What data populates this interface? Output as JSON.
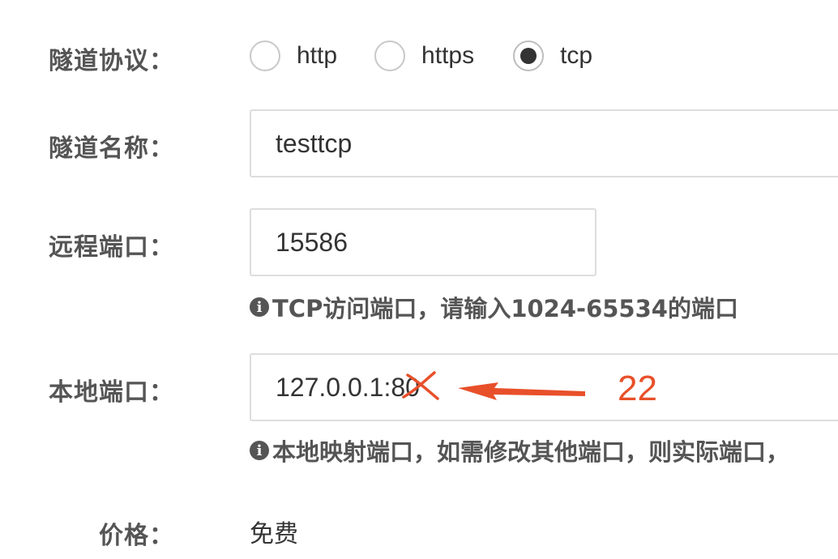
{
  "form": {
    "protocol": {
      "label": "隧道协议：",
      "options": [
        {
          "label": "http",
          "checked": false
        },
        {
          "label": "https",
          "checked": false
        },
        {
          "label": "tcp",
          "checked": true
        }
      ]
    },
    "tunnel_name": {
      "label": "隧道名称：",
      "value": "testtcp"
    },
    "remote_port": {
      "label": "远程端口：",
      "value": "15586",
      "help": "TCP访问端口，请输入1024-65534的端口"
    },
    "local_port": {
      "label": "本地端口：",
      "value": "127.0.0.1:80",
      "help": "本地映射端口，如需修改其他端口，则实际端口，"
    },
    "price": {
      "label": "价格：",
      "value": "免费"
    }
  },
  "annotation": {
    "replacement_value": "22",
    "color": "#e8502a"
  },
  "icons": {
    "help_icon": "info-circle-icon"
  }
}
